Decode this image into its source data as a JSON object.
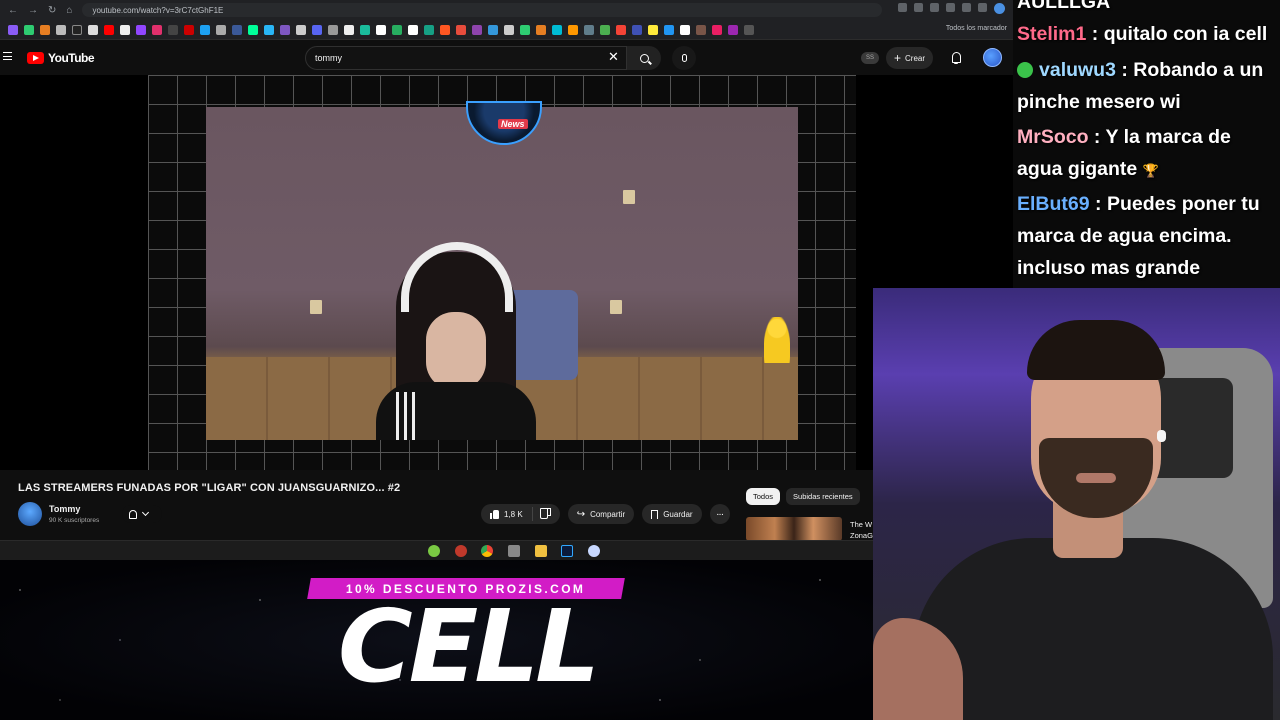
{
  "browser": {
    "url": "youtube.com/watch?v=3rC7ctGhF1E",
    "all_bookmarks_label": "Todos los marcador"
  },
  "youtube": {
    "logo_text": "YouTube",
    "search_value": "tommy",
    "create_label": "Crear",
    "ss_badge": "SS"
  },
  "video": {
    "title": "LAS STREAMERS FUNADAS POR \"LIGAR\" CON JUANSGUARNIZO... #2",
    "news_badge": "News",
    "channel_name": "Tommy",
    "channel_subs": "90 K suscriptores",
    "like_count": "1,8 K",
    "share_label": "Compartir",
    "save_label": "Guardar",
    "more_label": "···"
  },
  "related": {
    "chips": [
      "Todos",
      "Subidas recientes"
    ],
    "rec_title_line1": "The W",
    "rec_title_line2": "ZonaG"
  },
  "promo": {
    "banner_text": "10% DESCUENTO PROZIS.COM",
    "big_word": "CELL"
  },
  "chat": {
    "messages": [
      {
        "user": "AULLLGA",
        "text": "",
        "user_color": "#ffffff"
      },
      {
        "user": "Stelim1",
        "text": " : quitalo con ia cell",
        "user_color": "#ff6a8a"
      },
      {
        "user": "valuwu3",
        "text": " : Robando a un",
        "user_color": "#9fd8ff"
      },
      {
        "user": "",
        "text": "pinche mesero wi",
        "user_color": "#ffffff"
      },
      {
        "user": "MrSoco",
        "text": " : Y la marca de",
        "user_color": "#ffb0c0"
      },
      {
        "user": "",
        "text": "agua gigante",
        "user_color": "#ffffff"
      },
      {
        "user": "ElBut69",
        "text": " : Puedes poner tu",
        "user_color": "#6ab0ff"
      },
      {
        "user": "",
        "text": "marca de agua encima.",
        "user_color": "#ffffff"
      },
      {
        "user": "",
        "text": "incluso mas grande",
        "user_color": "#ffffff"
      }
    ]
  }
}
